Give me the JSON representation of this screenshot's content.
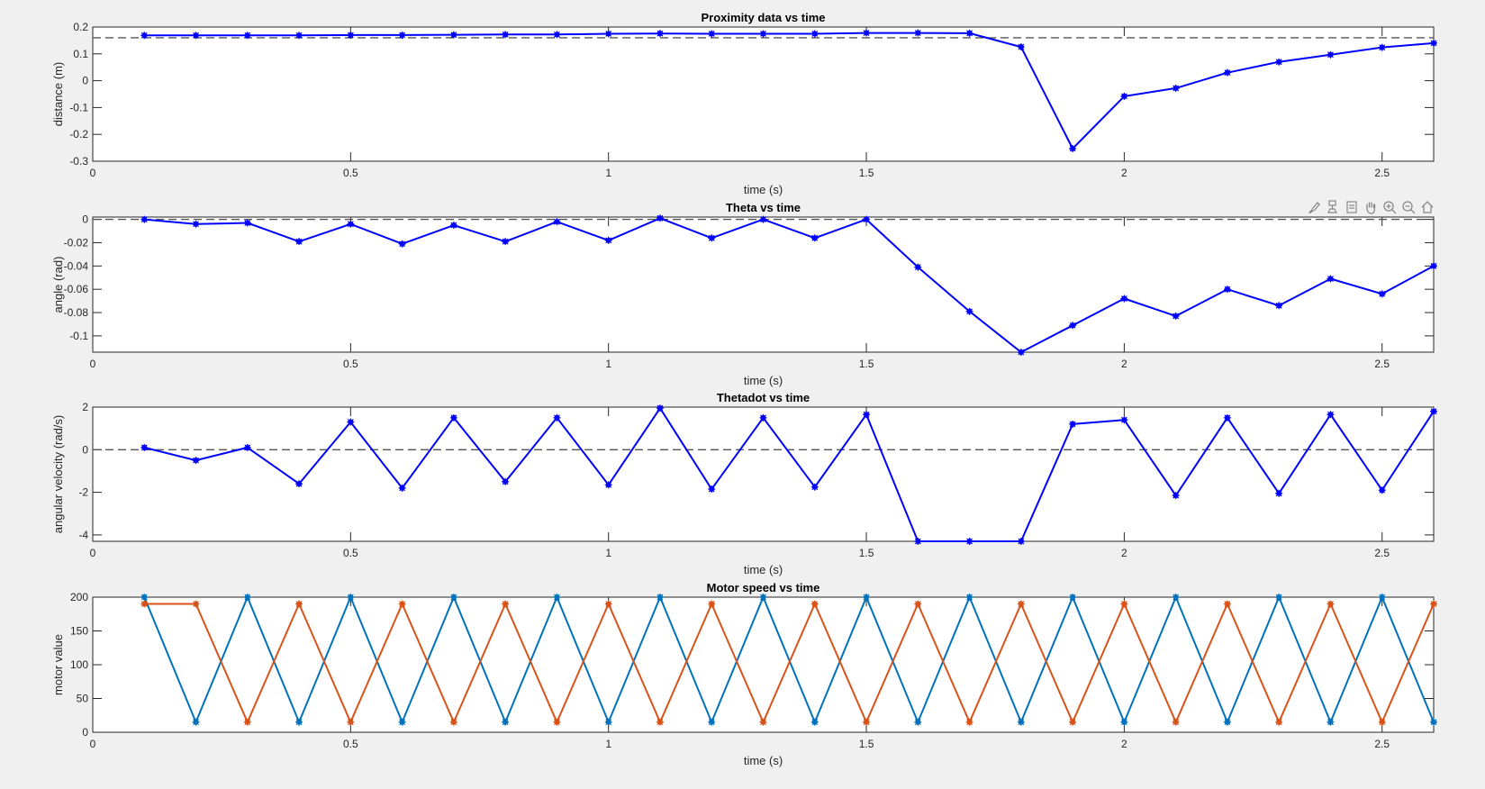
{
  "colors": {
    "figure_bg": "#f0f0f0",
    "axes_bg": "#ffffff",
    "axis": "#262626",
    "series_blue": "#0000ff",
    "series_motor1": "#0072bd",
    "series_motor2": "#d95319",
    "reference_line": "#555555"
  },
  "toolbar": {
    "icons": [
      "brush-icon",
      "data-tips-icon",
      "data-cursor-icon",
      "pan-icon",
      "zoom-in-icon",
      "zoom-out-icon",
      "home-icon"
    ]
  },
  "chart_data": [
    {
      "type": "line",
      "title": "Proximity data vs time",
      "xlabel": "time (s)",
      "ylabel": "distance (m)",
      "xlim": [
        0,
        2.6
      ],
      "ylim": [
        -0.3,
        0.2
      ],
      "xticks": [
        0,
        0.5,
        1,
        1.5,
        2,
        2.5
      ],
      "xtick_labels": [
        "0",
        "0.5",
        "1",
        "1.5",
        "2",
        "2.5"
      ],
      "yticks": [
        -0.3,
        -0.2,
        -0.1,
        0,
        0.1,
        0.2
      ],
      "ytick_labels": [
        "-0.3",
        "-0.2",
        "-0.1",
        "0",
        "0.1",
        "0.2"
      ],
      "reference_line": 0.16,
      "grid": false,
      "series": [
        {
          "x": [
            0.1,
            0.2,
            0.3,
            0.4,
            0.5,
            0.6,
            0.7,
            0.8,
            0.9,
            1.0,
            1.1,
            1.2,
            1.3,
            1.4,
            1.5,
            1.6,
            1.7,
            1.8,
            1.9,
            2.0,
            2.1,
            2.2,
            2.3,
            2.4,
            2.5,
            2.6
          ],
          "values": [
            0.169,
            0.169,
            0.169,
            0.169,
            0.17,
            0.17,
            0.171,
            0.172,
            0.172,
            0.175,
            0.176,
            0.175,
            0.175,
            0.175,
            0.178,
            0.178,
            0.177,
            0.126,
            -0.253,
            -0.058,
            -0.028,
            0.03,
            0.07,
            0.097,
            0.124,
            0.14
          ]
        }
      ]
    },
    {
      "type": "line",
      "title": "Theta vs time",
      "xlabel": "time (s)",
      "ylabel": "angle (rad)",
      "xlim": [
        0,
        2.6
      ],
      "ylim": [
        -0.114,
        0.002
      ],
      "xticks": [
        0,
        0.5,
        1,
        1.5,
        2,
        2.5
      ],
      "xtick_labels": [
        "0",
        "0.5",
        "1",
        "1.5",
        "2",
        "2.5"
      ],
      "yticks": [
        -0.1,
        -0.08,
        -0.06,
        -0.04,
        -0.02,
        0
      ],
      "ytick_labels": [
        "-0.1",
        "-0.08",
        "-0.06",
        "-0.04",
        "-0.02",
        "0"
      ],
      "reference_line": 0,
      "grid": false,
      "series": [
        {
          "x": [
            0.1,
            0.2,
            0.3,
            0.4,
            0.5,
            0.6,
            0.7,
            0.8,
            0.9,
            1.0,
            1.1,
            1.2,
            1.3,
            1.4,
            1.5,
            1.6,
            1.7,
            1.8,
            1.9,
            2.0,
            2.1,
            2.2,
            2.3,
            2.4,
            2.5,
            2.6
          ],
          "values": [
            0.0,
            -0.004,
            -0.003,
            -0.019,
            -0.004,
            -0.021,
            -0.005,
            -0.019,
            -0.002,
            -0.018,
            0.001,
            -0.016,
            0.0,
            -0.016,
            0.0,
            -0.041,
            -0.079,
            -0.114,
            -0.091,
            -0.068,
            -0.083,
            -0.06,
            -0.074,
            -0.051,
            -0.064,
            -0.04
          ]
        }
      ]
    },
    {
      "type": "line",
      "title": "Thetadot vs time",
      "xlabel": "time (s)",
      "ylabel": "angular velocity (rad/s)",
      "xlim": [
        0,
        2.6
      ],
      "ylim": [
        -4.3,
        2.0
      ],
      "xticks": [
        0,
        0.5,
        1,
        1.5,
        2,
        2.5
      ],
      "xtick_labels": [
        "0",
        "0.5",
        "1",
        "1.5",
        "2",
        "2.5"
      ],
      "yticks": [
        -4,
        -2,
        0,
        2
      ],
      "ytick_labels": [
        "-4",
        "-2",
        "0",
        "2"
      ],
      "reference_line": 0,
      "grid": false,
      "series": [
        {
          "x": [
            0.1,
            0.2,
            0.3,
            0.4,
            0.5,
            0.6,
            0.7,
            0.8,
            0.9,
            1.0,
            1.1,
            1.2,
            1.3,
            1.4,
            1.5,
            1.6,
            1.7,
            1.8,
            1.9,
            2.0,
            2.1,
            2.2,
            2.3,
            2.4,
            2.5,
            2.6
          ],
          "values": [
            0.1,
            -0.5,
            0.1,
            -1.6,
            1.3,
            -1.8,
            1.5,
            -1.5,
            1.5,
            -1.65,
            1.95,
            -1.85,
            1.5,
            -1.75,
            1.65,
            -4.3,
            -4.3,
            -4.3,
            1.2,
            1.4,
            -2.15,
            1.5,
            -2.05,
            1.65,
            -1.9,
            1.8
          ]
        }
      ]
    },
    {
      "type": "line",
      "title": "Motor speed vs time",
      "xlabel": "time (s)",
      "ylabel": "motor value",
      "xlim": [
        0,
        2.6
      ],
      "ylim": [
        0,
        200
      ],
      "xticks": [
        0,
        0.5,
        1,
        1.5,
        2,
        2.5
      ],
      "xtick_labels": [
        "0",
        "0.5",
        "1",
        "1.5",
        "2",
        "2.5"
      ],
      "yticks": [
        0,
        50,
        100,
        150,
        200
      ],
      "ytick_labels": [
        "0",
        "50",
        "100",
        "150",
        "200"
      ],
      "grid": false,
      "series": [
        {
          "color": "#0072bd",
          "x": [
            0.1,
            0.2,
            0.3,
            0.4,
            0.5,
            0.6,
            0.7,
            0.8,
            0.9,
            1.0,
            1.1,
            1.2,
            1.3,
            1.4,
            1.5,
            1.6,
            1.7,
            1.8,
            1.9,
            2.0,
            2.1,
            2.2,
            2.3,
            2.4,
            2.5,
            2.6
          ],
          "values": [
            200,
            15,
            200,
            15,
            200,
            15,
            200,
            15,
            200,
            15,
            200,
            15,
            200,
            15,
            200,
            15,
            200,
            15,
            200,
            15,
            200,
            15,
            200,
            15,
            200,
            15
          ]
        },
        {
          "color": "#d95319",
          "x": [
            0.1,
            0.2,
            0.3,
            0.4,
            0.5,
            0.6,
            0.7,
            0.8,
            0.9,
            1.0,
            1.1,
            1.2,
            1.3,
            1.4,
            1.5,
            1.6,
            1.7,
            1.8,
            1.9,
            2.0,
            2.1,
            2.2,
            2.3,
            2.4,
            2.5,
            2.6
          ],
          "values": [
            190,
            190,
            15,
            190,
            15,
            190,
            15,
            190,
            15,
            190,
            15,
            190,
            15,
            190,
            15,
            190,
            15,
            190,
            15,
            190,
            15,
            190,
            15,
            190,
            15,
            190
          ]
        }
      ]
    }
  ]
}
